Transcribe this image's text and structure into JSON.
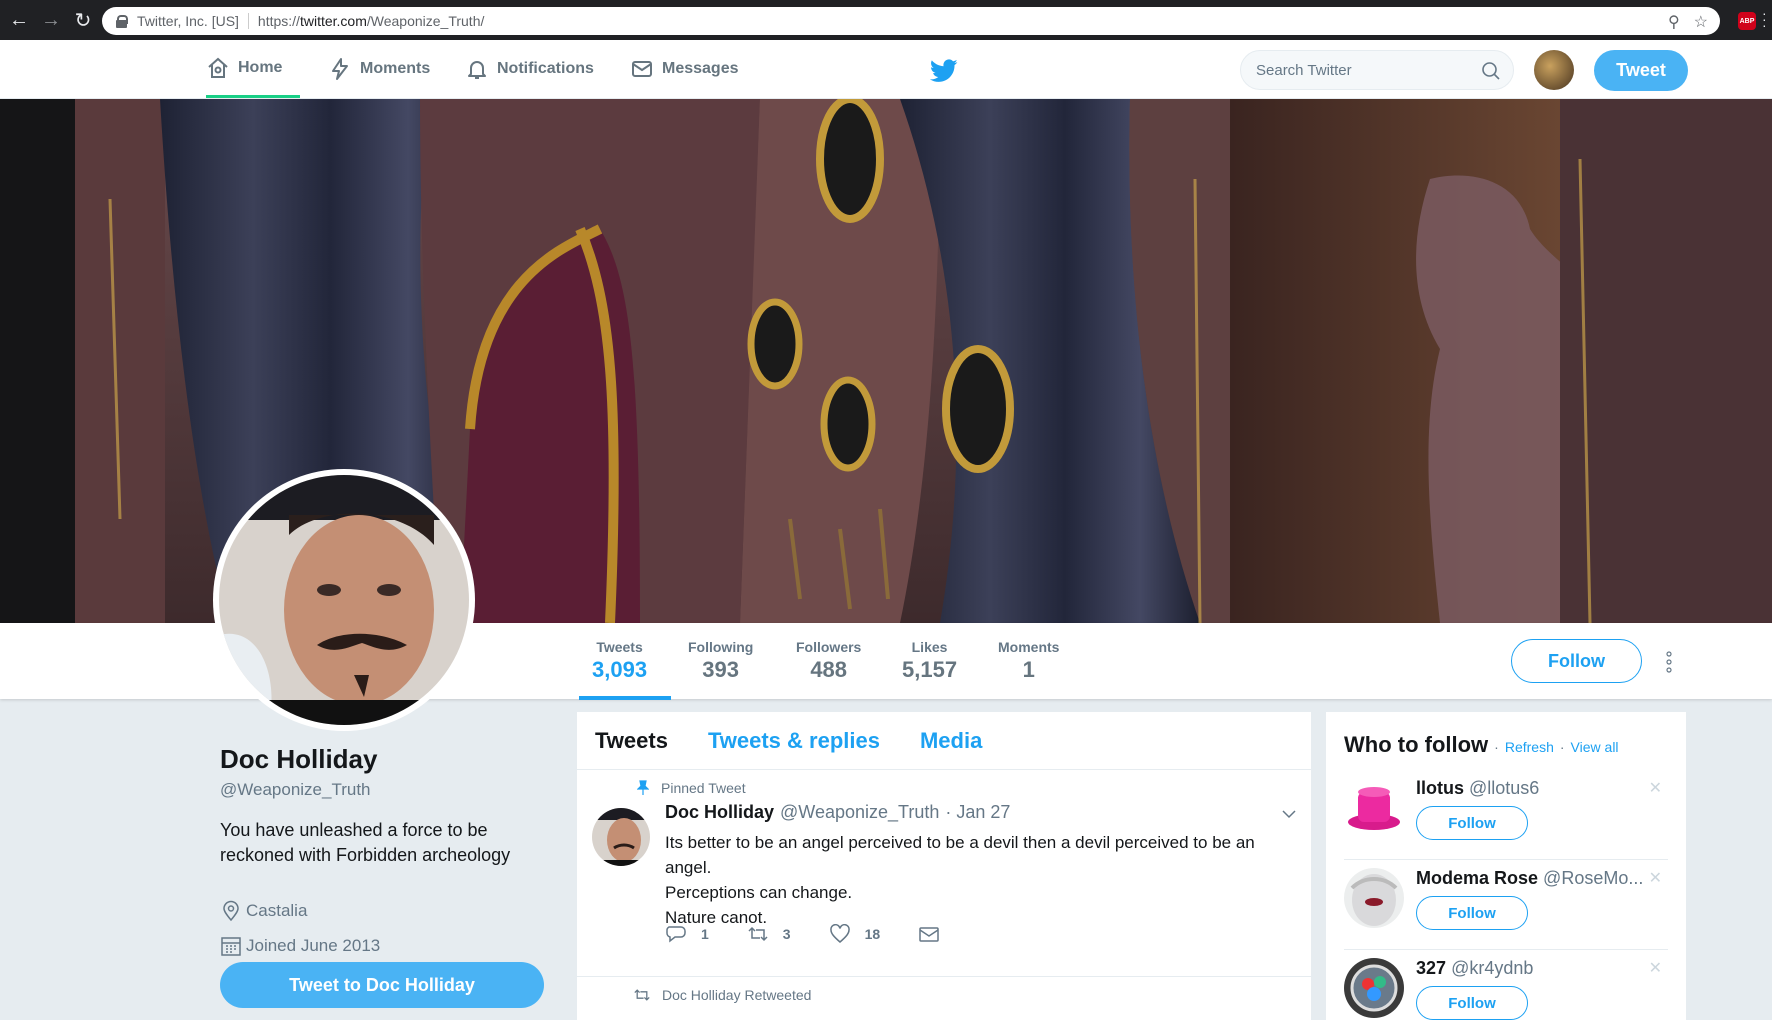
{
  "browser": {
    "site_label": "Twitter, Inc. [US]",
    "url_prefix": "https://",
    "url_host": "twitter.com",
    "url_path": "/Weaponize_Truth/",
    "abp_label": "ABP"
  },
  "nav": {
    "home": "Home",
    "moments": "Moments",
    "notifications": "Notifications",
    "messages": "Messages",
    "search_placeholder": "Search Twitter",
    "tweet_button": "Tweet",
    "accent": "#1da1f2"
  },
  "profile": {
    "name": "Doc Holliday",
    "handle": "@Weaponize_Truth",
    "bio": "You have unleashed a force to be reckoned with Forbidden archeology",
    "location": "Castalia",
    "joined": "Joined June 2013",
    "tweet_to_button": "Tweet to Doc Holliday",
    "follow_button": "Follow"
  },
  "stats": [
    {
      "label": "Tweets",
      "value": "3,093"
    },
    {
      "label": "Following",
      "value": "393"
    },
    {
      "label": "Followers",
      "value": "488"
    },
    {
      "label": "Likes",
      "value": "5,157"
    },
    {
      "label": "Moments",
      "value": "1"
    }
  ],
  "timeline": {
    "tabs": [
      "Tweets",
      "Tweets & replies",
      "Media"
    ],
    "pinned_label": "Pinned Tweet",
    "tweet": {
      "name": "Doc Holliday",
      "handle": "@Weaponize_Truth",
      "date": "· Jan 27",
      "lines": [
        "Its better to be an angel perceived to be a devil then a devil perceived to be an angel.",
        "Perceptions can change.",
        "Nature canot."
      ],
      "replies": "1",
      "retweets": "3",
      "likes": "18"
    },
    "retweeted_label": "Doc Holliday Retweeted"
  },
  "who_to_follow": {
    "title": "Who to follow",
    "refresh": "Refresh",
    "view_all": "View all",
    "separator": "·",
    "suggestions": [
      {
        "name": "llotus",
        "handle": "@llotus6",
        "follow": "Follow"
      },
      {
        "name": "Modema Rose",
        "handle": "@RoseMo...",
        "follow": "Follow"
      },
      {
        "name": "327",
        "handle": "@kr4ydnb",
        "follow": "Follow"
      }
    ]
  }
}
